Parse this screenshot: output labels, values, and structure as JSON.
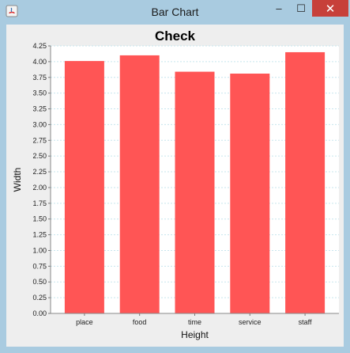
{
  "window": {
    "title": "Bar Chart",
    "min_glyph": "–",
    "max_glyph": "☐",
    "close_glyph": "✕"
  },
  "colors": {
    "bar": "#ff5555",
    "plot_background": "#ffffff",
    "gridline": "#c7e6ee"
  },
  "chart_data": {
    "type": "bar",
    "title": "Check",
    "xlabel": "Height",
    "ylabel": "Width",
    "categories": [
      "place",
      "food",
      "time",
      "service",
      "staff"
    ],
    "values": [
      4.01,
      4.1,
      3.84,
      3.81,
      4.15
    ],
    "ylim": [
      0,
      4.25
    ],
    "yticks": [
      "0.00",
      "0.25",
      "0.50",
      "0.75",
      "1.00",
      "1.25",
      "1.50",
      "1.75",
      "2.00",
      "2.25",
      "2.50",
      "2.75",
      "3.00",
      "3.25",
      "3.50",
      "3.75",
      "4.00",
      "4.25"
    ],
    "grid": true
  }
}
